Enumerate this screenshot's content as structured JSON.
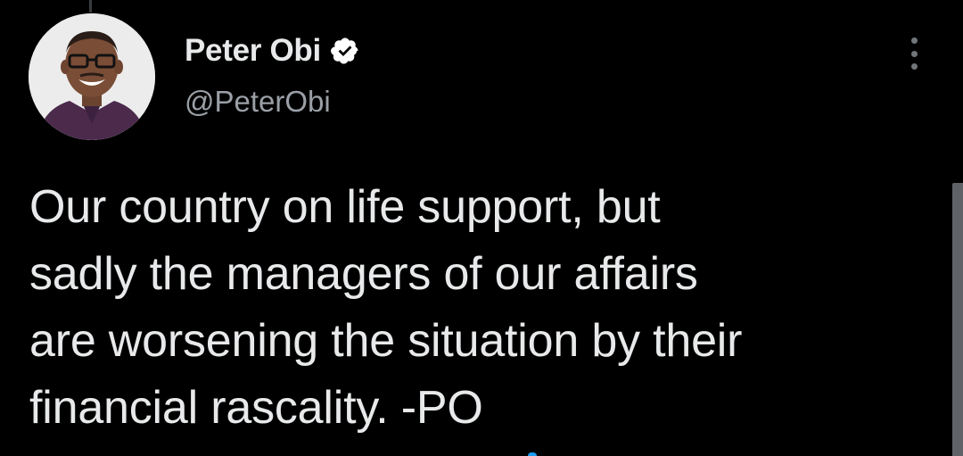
{
  "author": {
    "display_name": "Peter Obi",
    "handle": "@PeterObi",
    "verified": true
  },
  "tweet": {
    "lines": [
      "Our country on life support, but",
      "sadly the managers of our affairs",
      "are worsening the situation by their",
      "financial rascality. -PO"
    ]
  },
  "icons": {
    "avatar": "profile-photo",
    "verified": "verified-badge-icon",
    "more": "more-vertical-icon"
  },
  "colors": {
    "background": "#000000",
    "text": "#e7e9ea",
    "secondary_text": "#9aa0a6",
    "accent": "#1d9bf0"
  }
}
